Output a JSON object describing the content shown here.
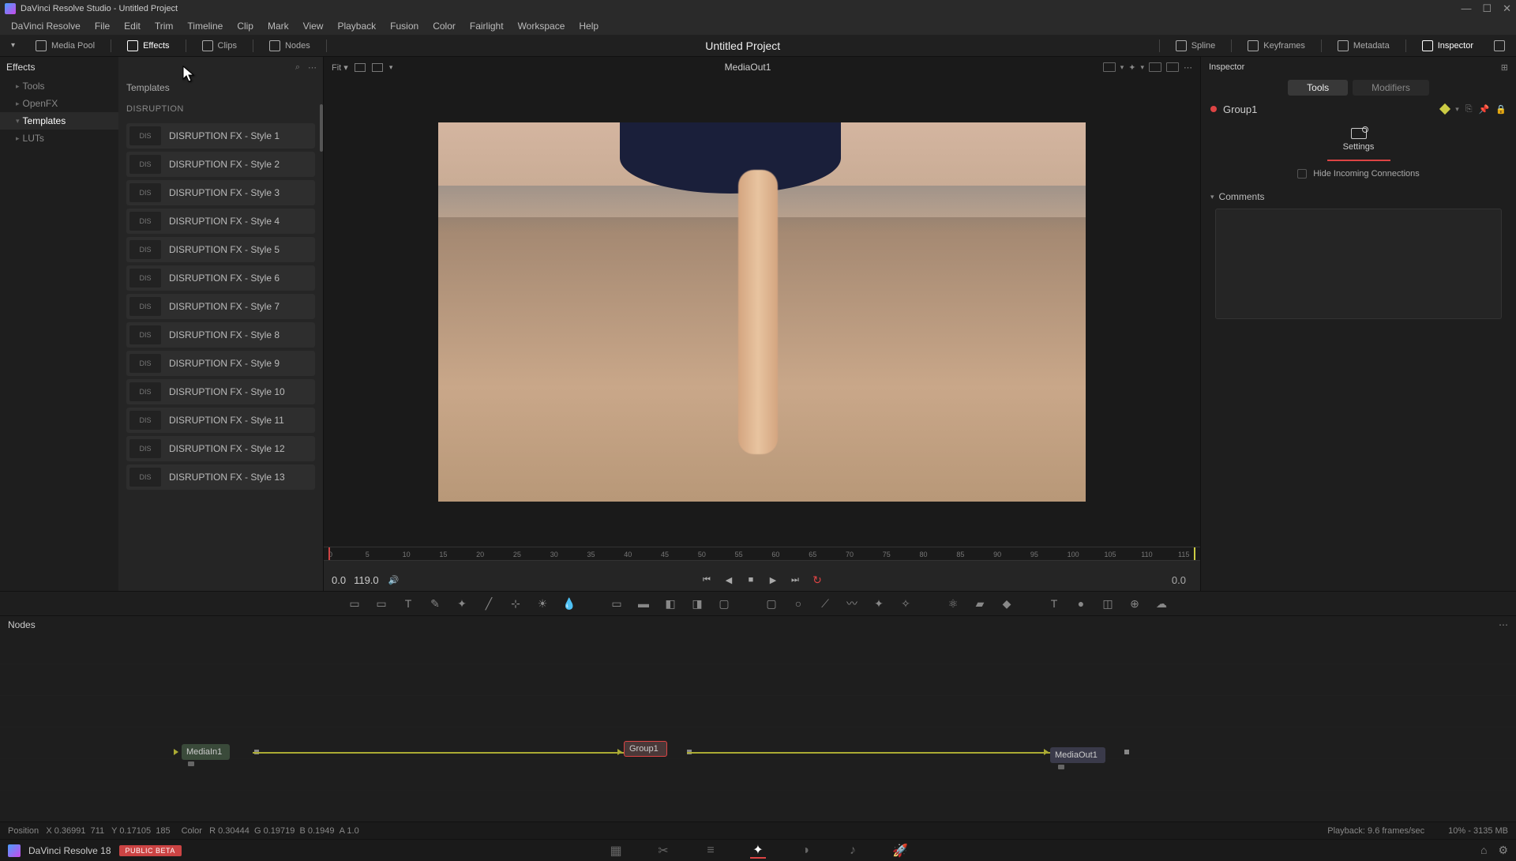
{
  "titlebar": {
    "title": "DaVinci Resolve Studio - Untitled Project"
  },
  "menu": [
    "DaVinci Resolve",
    "File",
    "Edit",
    "Trim",
    "Timeline",
    "Clip",
    "Mark",
    "View",
    "Playback",
    "Fusion",
    "Color",
    "Fairlight",
    "Workspace",
    "Help"
  ],
  "topbar": {
    "left": [
      {
        "label": "Media Pool"
      },
      {
        "label": "Effects",
        "active": true
      },
      {
        "label": "Clips"
      },
      {
        "label": "Nodes"
      }
    ],
    "center": "Untitled Project",
    "right": [
      {
        "label": "Spline"
      },
      {
        "label": "Keyframes"
      },
      {
        "label": "Metadata"
      },
      {
        "label": "Inspector",
        "active": true
      }
    ]
  },
  "effects": {
    "header": "Effects",
    "tree": [
      {
        "label": "Tools"
      },
      {
        "label": "OpenFX"
      },
      {
        "label": "Templates",
        "sel": true
      },
      {
        "label": "LUTs"
      }
    ],
    "list_header": "Templates",
    "category": "DISRUPTION",
    "thumb_text": "DIS",
    "items": [
      "DISRUPTION FX - Style 1",
      "DISRUPTION FX - Style 2",
      "DISRUPTION FX - Style 3",
      "DISRUPTION FX - Style 4",
      "DISRUPTION FX - Style 5",
      "DISRUPTION FX - Style 6",
      "DISRUPTION FX - Style 7",
      "DISRUPTION FX - Style 8",
      "DISRUPTION FX - Style 9",
      "DISRUPTION FX - Style 10",
      "DISRUPTION FX - Style 11",
      "DISRUPTION FX - Style 12",
      "DISRUPTION FX - Style 13"
    ]
  },
  "viewer": {
    "fit": "Fit",
    "name": "MediaOut1",
    "transport": {
      "in": "0.0",
      "out": "119.0",
      "cur": "0.0"
    },
    "ruler": [
      0,
      5,
      10,
      15,
      20,
      25,
      30,
      35,
      40,
      45,
      50,
      55,
      60,
      65,
      70,
      75,
      80,
      85,
      90,
      95,
      100,
      105,
      110,
      115
    ]
  },
  "inspector": {
    "header": "Inspector",
    "tabs": [
      {
        "label": "Tools",
        "active": true
      },
      {
        "label": "Modifiers"
      }
    ],
    "node": "Group1",
    "settings_label": "Settings",
    "hide_incoming": "Hide Incoming Connections",
    "comments": "Comments"
  },
  "nodes_panel": {
    "header": "Nodes",
    "nodes": {
      "media_in": "MediaIn1",
      "group": "Group1",
      "media_out": "MediaOut1"
    }
  },
  "status": {
    "pos_label": "Position",
    "x_label": "X",
    "x": "0.36991",
    "xp": "711",
    "y_label": "Y",
    "y": "0.17105",
    "yp": "185",
    "color_label": "Color",
    "r": "R 0.30444",
    "g": "G 0.19719",
    "b": "B 0.1949",
    "a": "A 1.0",
    "playback": "Playback: 9.6 frames/sec",
    "mem": "10% - 3135 MB"
  },
  "bottom": {
    "app": "DaVinci Resolve 18",
    "badge": "PUBLIC BETA"
  }
}
